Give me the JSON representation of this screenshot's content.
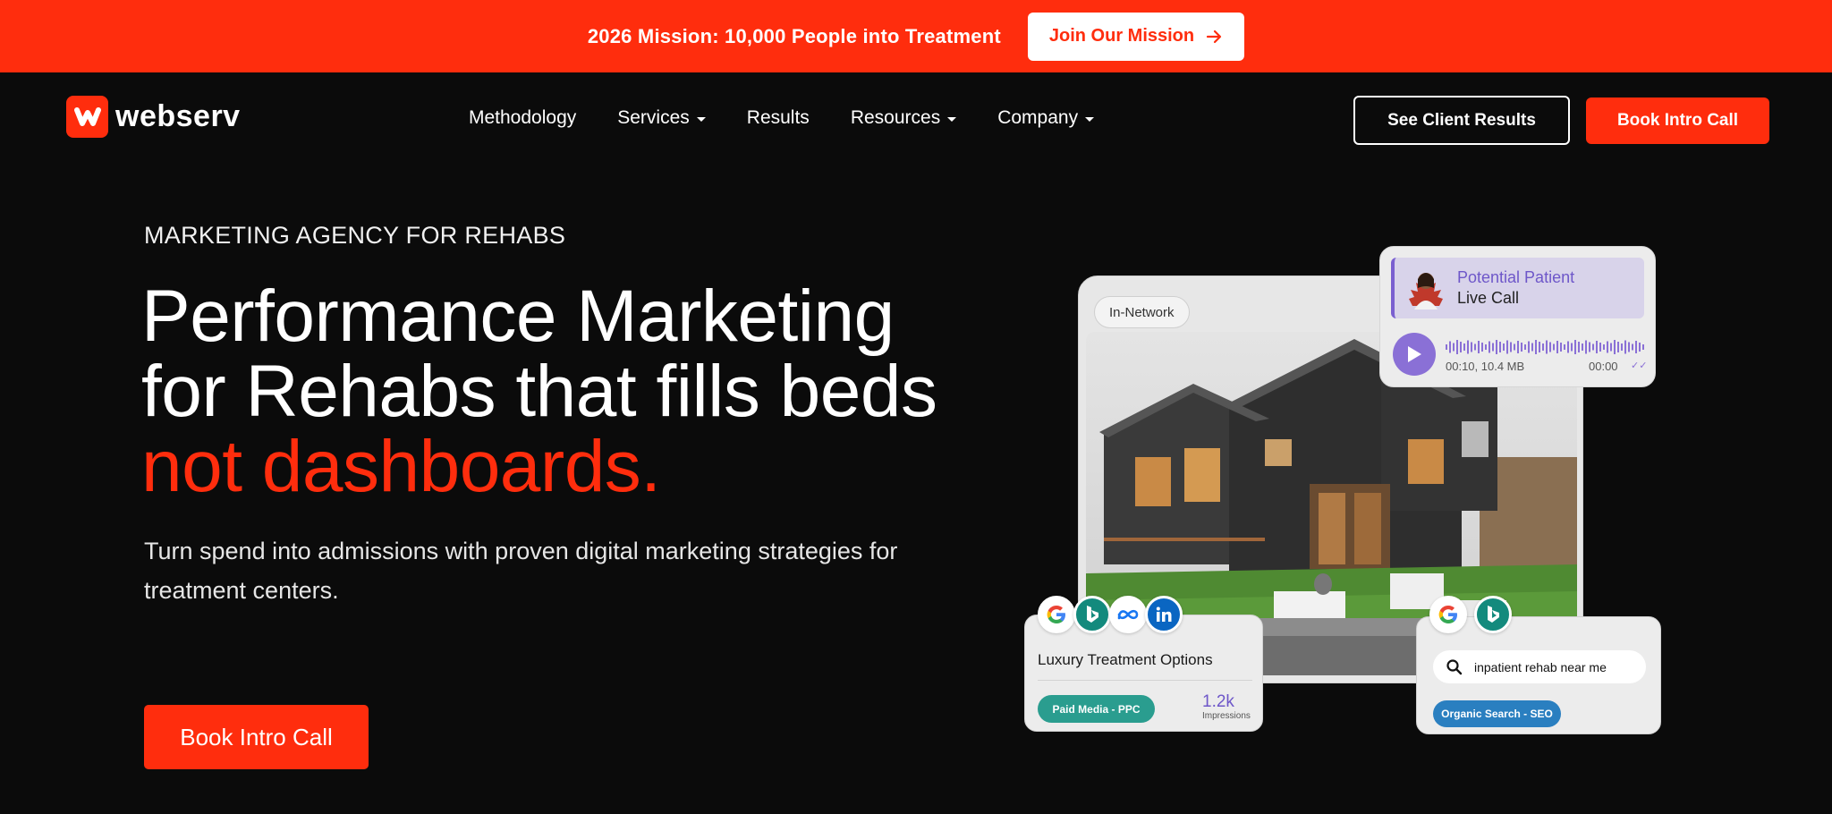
{
  "banner": {
    "text": "2026 Mission: 10,000 People into Treatment",
    "button": "Join Our Mission"
  },
  "nav": {
    "logo": "webserv",
    "items": [
      {
        "label": "Methodology",
        "has_dropdown": false
      },
      {
        "label": "Services",
        "has_dropdown": true
      },
      {
        "label": "Results",
        "has_dropdown": false
      },
      {
        "label": "Resources",
        "has_dropdown": true
      },
      {
        "label": "Company",
        "has_dropdown": true
      }
    ],
    "outline_button": "See Client Results",
    "solid_button": "Book Intro Call"
  },
  "hero": {
    "eyebrow": "MARKETING AGENCY FOR REHABS",
    "headline_line1": "Performance Marketing",
    "headline_line2": "for Rehabs that fills beds",
    "headline_accent": "not dashboards.",
    "subtext": "Turn spend into admissions with proven digital marketing strategies for treatment centers.",
    "cta": "Book Intro Call"
  },
  "visual": {
    "tag": "In-Network",
    "call": {
      "title": "Potential Patient",
      "subtitle": "Live Call",
      "meta": "00:10, 10.4 MB",
      "time": "00:00"
    },
    "ppc": {
      "title": "Luxury Treatment Options",
      "pill": "Paid Media - PPC",
      "value": "1.2k",
      "value_label": "Impressions"
    },
    "seo": {
      "query": "inpatient rehab near me",
      "pill": "Organic Search - SEO"
    }
  },
  "colors": {
    "brand": "#ff2d0d",
    "background": "#0b0b0b",
    "purple": "#7a5fd0",
    "teal": "#2a9d8f",
    "blue": "#2a7fc0"
  },
  "icons": [
    "arrow-right-icon",
    "caret-down-icon",
    "play-icon",
    "search-icon",
    "google-icon",
    "bing-icon",
    "meta-icon",
    "linkedin-icon"
  ]
}
